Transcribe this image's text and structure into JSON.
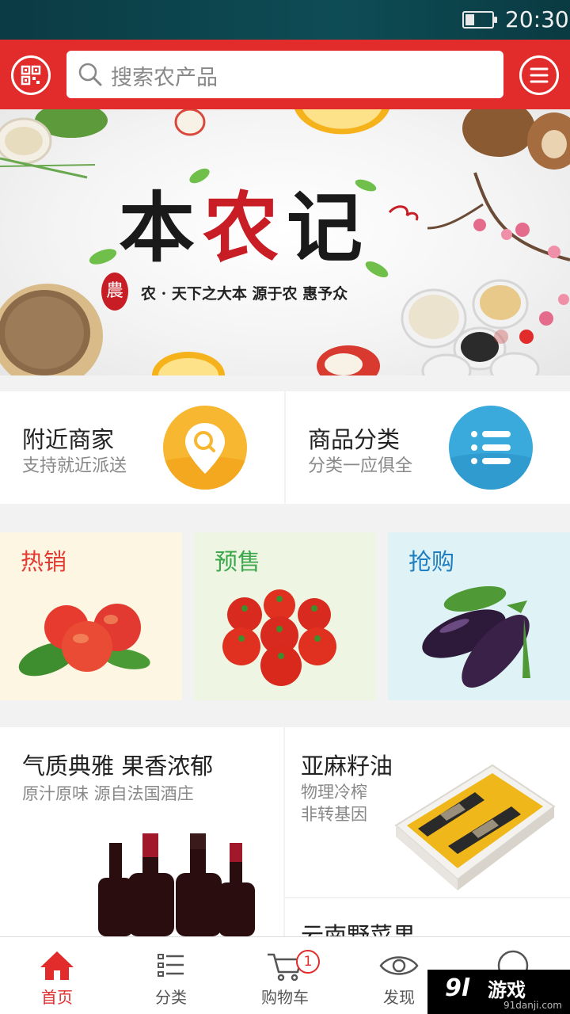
{
  "status_bar": {
    "time": "20:30",
    "battery_level": 0.35
  },
  "header": {
    "search_placeholder": "搜索农产品"
  },
  "banner": {
    "title_part1": "本",
    "title_part2": "农",
    "title_part3": "记",
    "seal": "農",
    "subtitle": "农 · 天下之大本    源于农  惠予众",
    "page_count": 2,
    "active_page": 2
  },
  "quick_links": [
    {
      "title": "附近商家",
      "subtitle": "支持就近派送"
    },
    {
      "title": "商品分类",
      "subtitle": "分类一应俱全"
    }
  ],
  "categories": [
    {
      "label": "热销",
      "color": "#e33b32"
    },
    {
      "label": "预售",
      "color": "#3aa84a"
    },
    {
      "label": "抢购",
      "color": "#1e7fc2"
    }
  ],
  "promos": {
    "left": {
      "title": "气质典雅 果香浓郁",
      "subtitle": "原汁原味 源自法国酒庄"
    },
    "right_top": {
      "title": "亚麻籽油",
      "line1": "物理冷榨",
      "line2": "非转基因"
    },
    "right_bottom": {
      "title": "云南野菜果"
    }
  },
  "tabbar": {
    "tabs": [
      {
        "label": "首页"
      },
      {
        "label": "分类"
      },
      {
        "label": "购物车"
      },
      {
        "label": "发现"
      }
    ],
    "cart_badge": "1",
    "active": "首页"
  },
  "watermark": {
    "logo": "9l",
    "main": "游戏",
    "sub": "91danji.com"
  },
  "colors": {
    "brand_red": "#e22b2b",
    "location_yellow": "#f7b731",
    "category_blue": "#3aa9dc"
  }
}
